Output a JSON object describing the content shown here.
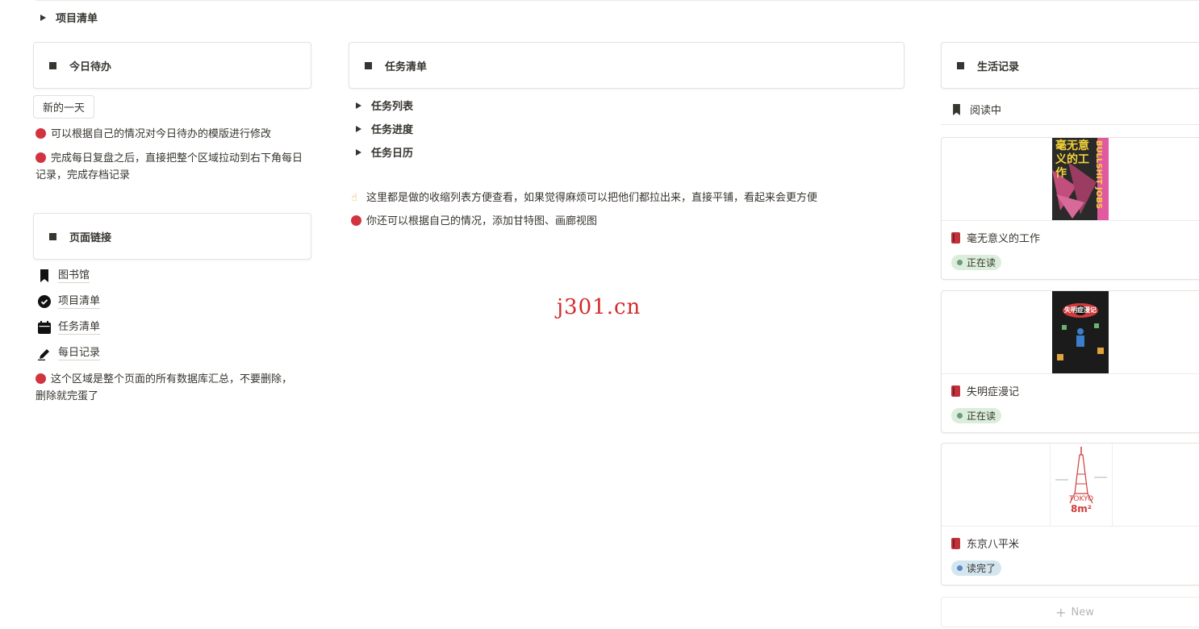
{
  "top_toggle": {
    "label": "项目清单"
  },
  "left": {
    "today_card": {
      "title": "今日待办"
    },
    "new_day_button": "新的一天",
    "notes": [
      "可以根据自己的情况对今日待办的模版进行修改",
      "完成每日复盘之后，直接把整个区域拉动到右下角每日记录，完成存档记录"
    ],
    "links_card": {
      "title": "页面链接"
    },
    "links": [
      {
        "label": "图书馆",
        "icon": "bookmark-icon"
      },
      {
        "label": "项目清单",
        "icon": "check-circle-icon"
      },
      {
        "label": "任务清单",
        "icon": "calendar-icon"
      },
      {
        "label": "每日记录",
        "icon": "pen-icon"
      }
    ],
    "links_note": "这个区域是整个页面的所有数据库汇总，不要删除，删除就完蛋了"
  },
  "middle": {
    "card": {
      "title": "任务清单"
    },
    "toggles": [
      "任务列表",
      "任务进度",
      "任务日历"
    ],
    "tip": "这里都是做的收缩列表方便查看，如果觉得麻烦可以把他们都拉出来，直接平铺，看起来会更方便",
    "note": "你还可以根据自己的情况，添加甘特图、画廊视图"
  },
  "watermark": "j301.cn",
  "right": {
    "card": {
      "title": "生活记录"
    },
    "view_tab": {
      "label": "阅读中",
      "icon": "bookmark-icon"
    },
    "books": [
      {
        "title": "毫无意义的工作",
        "status": "正在读",
        "status_bg": "#dbeddb",
        "status_dot": "#6c9b7d"
      },
      {
        "title": "失明症漫记",
        "status": "正在读",
        "status_bg": "#dbeddb",
        "status_dot": "#6c9b7d"
      },
      {
        "title": "东京八平米",
        "status": "读完了",
        "status_bg": "#d3e5ef",
        "status_dot": "#5e87c9"
      }
    ],
    "covers": [
      {
        "text_main": "毫无意义的工作",
        "text_side": "BULLSHIT JOBS"
      },
      {
        "text_main": "失明症漫记"
      },
      {
        "text_main": "TOKYO",
        "text_sub": "8m²"
      }
    ],
    "new_label": "New"
  },
  "colors": {
    "accent_red": "#d1343f",
    "text": "#37352f",
    "border": "#e3e2e0"
  }
}
